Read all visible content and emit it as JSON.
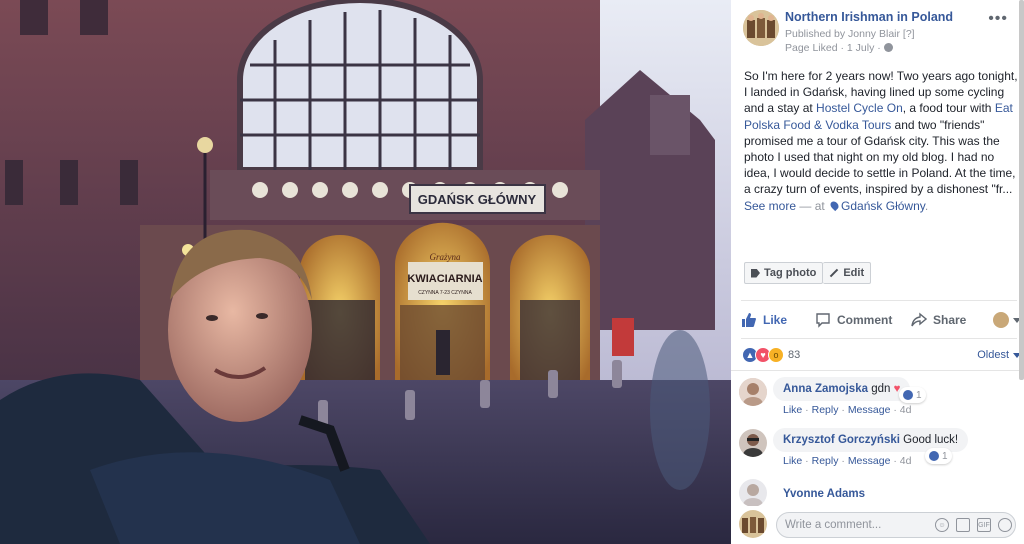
{
  "post": {
    "page_name": "Northern Irishman in Poland",
    "published_by": "Published by Jonny Blair",
    "published_help": "[?]",
    "page_liked": "Page Liked",
    "separator": "·",
    "date": "1 July",
    "more_label": "•••",
    "text_1": "So I'm here for 2 years now! Two years ago tonight, I landed in Gdańsk, having lined up some cycling and a stay at ",
    "link_hostel": "Hostel Cycle On",
    "text_2": ", a food tour with ",
    "link_tours": "Eat Polska Food & Vodka Tours",
    "text_3": " and two \"friends\" promised me a tour of Gdańsk city. This was the photo I used that night on my old blog. I had no idea, I would decide to settle in Poland. At the time, a crazy turn of events, inspired by a dishonest \"fr...",
    "see_more": "See more",
    "at_text": " — at ",
    "location": "Gdańsk Główny",
    "location_suffix": "."
  },
  "photo": {
    "station_sign": "GDAŃSK GŁÓWNY",
    "shop_sign": "KWIACIARNIA",
    "shop_script": "Grażyna",
    "shop_hours": "CZYNNA 7-23 CZYNNA"
  },
  "tag_actions": {
    "tag_label": "Tag photo",
    "edit_label": "Edit"
  },
  "actions": {
    "like": "Like",
    "comment": "Comment",
    "share": "Share"
  },
  "reactions": {
    "count": "83",
    "sort": "Oldest"
  },
  "comments": [
    {
      "author": "Anna Zamojska",
      "text": "gdn",
      "like": "Like",
      "reply": "Reply",
      "message": "Message",
      "time": "4d",
      "likes": "1"
    },
    {
      "author": "Krzysztof Gorczyński",
      "text": "Good luck!",
      "like": "Like",
      "reply": "Reply",
      "message": "Message",
      "time": "4d",
      "likes": "1"
    },
    {
      "author": "Yvonne Adams",
      "text": ""
    }
  ],
  "compose": {
    "placeholder": "Write a comment..."
  },
  "colors": {
    "link": "#365899",
    "like_blue": "#4267b2",
    "love_red": "#f25268",
    "wow_yellow": "#f7b125"
  }
}
